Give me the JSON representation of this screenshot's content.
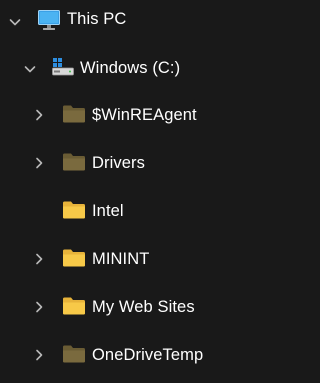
{
  "tree": {
    "this_pc": {
      "label": "This PC",
      "icon": "monitor-icon",
      "expanded": true
    },
    "drive": {
      "label": "Windows (C:)",
      "icon": "windows-drive-icon",
      "expanded": true
    },
    "folders": [
      {
        "label": "$WinREAgent",
        "icon": "folder-icon",
        "style": "dim",
        "has_children": true
      },
      {
        "label": "Drivers",
        "icon": "folder-icon",
        "style": "dim",
        "has_children": true
      },
      {
        "label": "Intel",
        "icon": "folder-icon",
        "style": "bright",
        "has_children": false
      },
      {
        "label": "MININT",
        "icon": "folder-icon",
        "style": "bright",
        "has_children": true
      },
      {
        "label": "My Web Sites",
        "icon": "folder-icon",
        "style": "bright",
        "has_children": true
      },
      {
        "label": "OneDriveTemp",
        "icon": "folder-icon",
        "style": "dim",
        "has_children": true
      }
    ]
  },
  "colors": {
    "background": "#191919",
    "text": "#ffffff",
    "chevron": "#b8b8b8",
    "folder_bright": "#f7c948",
    "folder_bright_tab": "#e7b33a",
    "folder_dim": "#7a6a3e",
    "folder_dim_tab": "#6a5c34",
    "monitor_screen": "#3aa0e6"
  }
}
